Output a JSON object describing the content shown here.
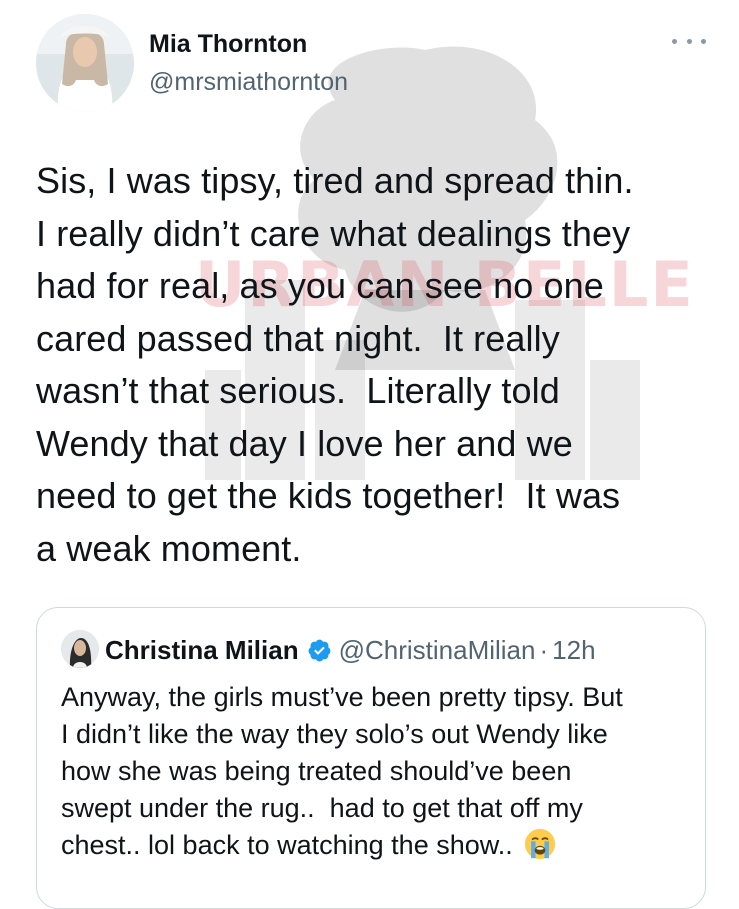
{
  "watermark": {
    "text": "URBAN BELLE"
  },
  "tweet": {
    "author": {
      "display_name": "Mia Thornton",
      "handle": "@mrsmiathornton"
    },
    "more_icon": "more-horizontal-icon",
    "body": "Sis, I was tipsy, tired and spread thin.\nI really didn’t care what dealings they\nhad for real, as you can see no one\ncared passed that night.  It really\nwasn’t that serious.  Literally told\nWendy that day I love her and we\nneed to get the kids together!  It was\na weak moment."
  },
  "quoted_tweet": {
    "author": {
      "display_name": "Christina Milian",
      "handle": "@ChristinaMilian",
      "verified": true
    },
    "separator": "·",
    "time": "12h",
    "body": "Anyway, the girls must’ve been pretty tipsy. But\nI didn’t like the way they solo’s out Wendy like\nhow she was being treated should’ve been\nswept under the rug..  had to get that off my\nchest.. lol back to watching the show.. ",
    "emoji": "loudly-crying-face-emoji"
  },
  "colors": {
    "text_primary": "#0f1419",
    "text_secondary": "#536471",
    "border": "#cfd9de",
    "verified_blue": "#1d9bf0"
  }
}
